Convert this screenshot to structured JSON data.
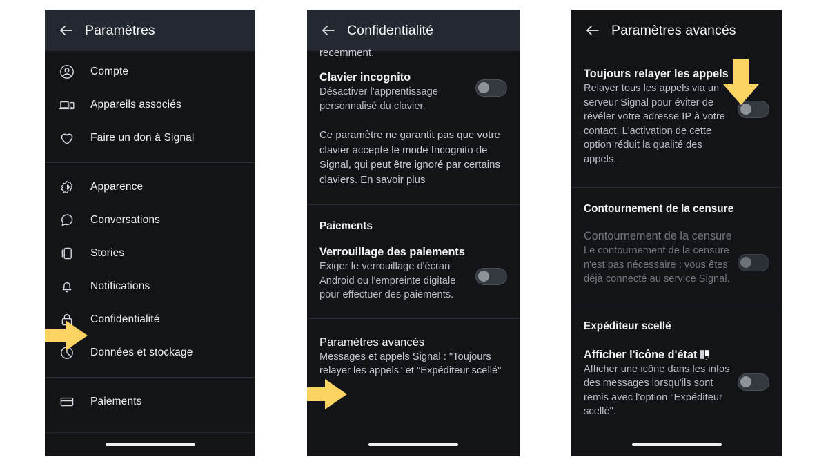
{
  "panels": {
    "settings": {
      "header": {
        "title": "Paramètres",
        "back_icon": "arrow-left-icon"
      },
      "groups": [
        {
          "items": [
            {
              "icon": "account-icon",
              "label": "Compte"
            },
            {
              "icon": "linked-devices-icon",
              "label": "Appareils associés"
            },
            {
              "icon": "heart-icon",
              "label": "Faire un don à Signal"
            }
          ]
        },
        {
          "items": [
            {
              "icon": "appearance-icon",
              "label": "Apparence"
            },
            {
              "icon": "chat-bubble-icon",
              "label": "Conversations"
            },
            {
              "icon": "stories-icon",
              "label": "Stories"
            },
            {
              "icon": "bell-icon",
              "label": "Notifications"
            },
            {
              "icon": "lock-icon",
              "label": "Confidentialité"
            },
            {
              "icon": "pie-chart-icon",
              "label": "Données et stockage"
            }
          ]
        },
        {
          "items": [
            {
              "icon": "credit-card-icon",
              "label": "Paiements"
            }
          ]
        }
      ],
      "arrow": {
        "type": "arrow-right",
        "points_to": "Confidentialité",
        "color": "#FBD363"
      }
    },
    "privacy": {
      "header": {
        "title": "Confidentialité",
        "back_icon": "arrow-left-icon"
      },
      "clipped_text": "recemment.",
      "incognito": {
        "title": "Clavier incognito",
        "subtitle": "Désactiver l'apprentissage personnalisé du clavier.",
        "toggle_on": false
      },
      "note": "Ce paramètre ne garantit pas que votre clavier accepte le mode Incognito de Signal, qui peut être ignoré par certains claviers. En savoir plus",
      "payments_section": "Paiements",
      "payment_lock": {
        "title": "Verrouillage des paiements",
        "subtitle": "Exiger le verrouillage d'écran Android ou l'empreinte digitale pour effectuer des paiements.",
        "toggle_on": false
      },
      "advanced": {
        "title": "Paramètres avancés",
        "subtitle": "Messages et appels Signal : \"Toujours relayer les appels\" et \"Expéditeur scellé\""
      },
      "arrow": {
        "type": "arrow-right",
        "points_to": "Paramètres avancés",
        "color": "#FBD363"
      }
    },
    "advanced": {
      "header": {
        "title": "Paramètres avancés",
        "back_icon": "arrow-left-icon"
      },
      "always_relay": {
        "title": "Toujours relayer les appels",
        "subtitle": "Relayer tous les appels via un serveur Signal pour éviter de révéler votre adresse IP à votre contact. L'activation de cette option réduit la qualité des appels.",
        "toggle_on": false
      },
      "censorship_section": "Contournement de la censure",
      "censorship": {
        "title": "Contournement de la censure",
        "subtitle": "Le contournement de la censure n'est pas nécessaire : vous êtes déjà connecté au service Signal.",
        "toggle_on": false,
        "disabled": true
      },
      "sealed_section": "Expéditeur scellé",
      "sealed_icon_setting": {
        "title": "Afficher l'icône d'état",
        "title_glyph": "sealed-sender-icon",
        "subtitle": "Afficher une icône dans les infos des messages lorsqu'ils sont remis avec l'option \"Expéditeur scellé\".",
        "toggle_on": false
      },
      "arrow": {
        "type": "arrow-down",
        "points_to": "Toujours relayer les appels toggle",
        "color": "#FBD363"
      }
    }
  },
  "theme": {
    "page_background": "#ffffff",
    "screen_background": "#121417",
    "header_shade": "#242830",
    "accent_arrow": "#FBD363",
    "text_primary": "#f2f4f6",
    "text_secondary": "#b9bdc3",
    "text_disabled": "#72767d",
    "divider": "#262a31"
  }
}
